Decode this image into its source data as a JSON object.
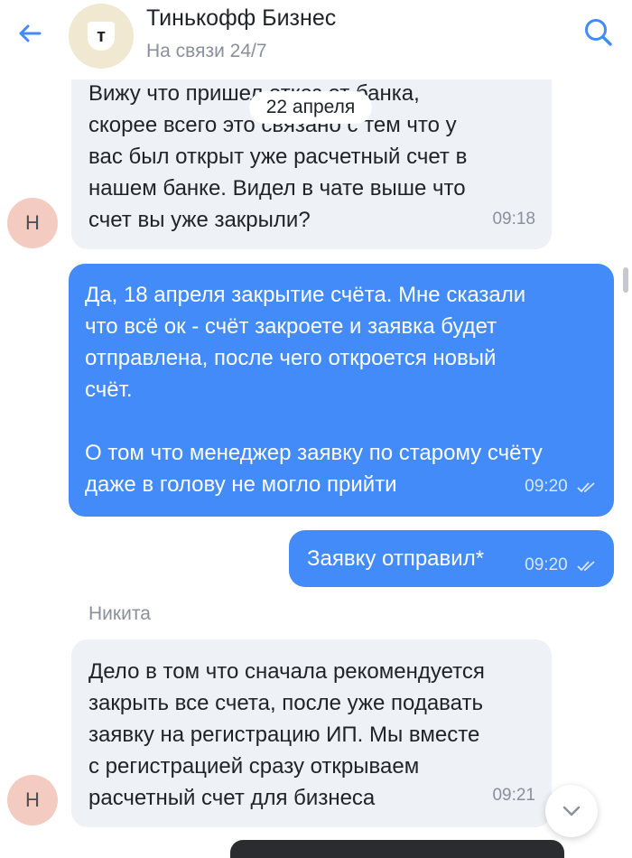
{
  "header": {
    "title": "Тинькофф Бизнес",
    "status": "На связи 24/7",
    "logo_letter": "т"
  },
  "date_divider": "22 апреля",
  "messages": [
    {
      "direction": "incoming",
      "lines": [
        "Вижу что пришел отказ от банка,",
        "скорее всего это связано с тем что у",
        "вас был открыт уже расчетный счет в",
        "нашем банке. Видел в чате выше что",
        "счет вы уже закрыли?"
      ],
      "time": "09:18",
      "avatar_letter": "Н"
    },
    {
      "direction": "outgoing",
      "lines": [
        "Да, 18 апреля закрытие счёта. Мне сказали",
        "что всё ок - счёт закроете и заявка будет",
        "отправлена, после чего откроется новый",
        "счёт.",
        "",
        "О том что менеджер заявку по старому счёту",
        "даже в голову не могло прийти"
      ],
      "time": "09:20",
      "status": "read"
    },
    {
      "direction": "outgoing",
      "lines": [
        "Заявку отправил*"
      ],
      "time": "09:20",
      "status": "read"
    },
    {
      "direction": "incoming",
      "sender": "Никита",
      "lines": [
        "Дело в том что сначала рекомендуется",
        "закрыть все счета, после уже подавать",
        "заявку на регистрацию ИП. Мы вместе",
        "с регистрацией сразу открываем",
        "расчетный счет для бизнеса"
      ],
      "time": "09:21",
      "avatar_letter": "Н"
    }
  ],
  "colors": {
    "accent": "#428bf9",
    "incoming_bubble": "#eef1f5",
    "avatar_bg": "#f3cbc1",
    "logo_bg": "#f0e8d0"
  },
  "icons": {
    "back": "arrow-left-icon",
    "search": "search-icon",
    "scroll_down": "chevron-down-icon",
    "read_status": "double-check-icon"
  }
}
